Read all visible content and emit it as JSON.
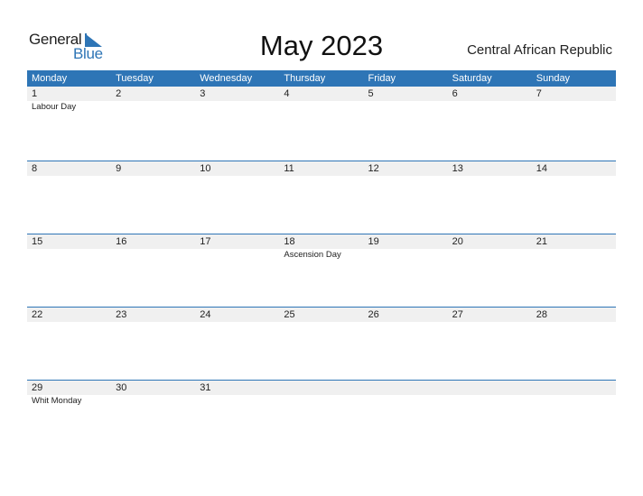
{
  "logo": {
    "line1": "General",
    "line2": "Blue"
  },
  "title": "May 2023",
  "country": "Central African Republic",
  "colors": {
    "accent": "#2e75b6",
    "strip": "#f0f0f0"
  },
  "weekdays": [
    "Monday",
    "Tuesday",
    "Wednesday",
    "Thursday",
    "Friday",
    "Saturday",
    "Sunday"
  ],
  "weeks": [
    [
      {
        "day": "1",
        "holiday": "Labour Day"
      },
      {
        "day": "2",
        "holiday": ""
      },
      {
        "day": "3",
        "holiday": ""
      },
      {
        "day": "4",
        "holiday": ""
      },
      {
        "day": "5",
        "holiday": ""
      },
      {
        "day": "6",
        "holiday": ""
      },
      {
        "day": "7",
        "holiday": ""
      }
    ],
    [
      {
        "day": "8",
        "holiday": ""
      },
      {
        "day": "9",
        "holiday": ""
      },
      {
        "day": "10",
        "holiday": ""
      },
      {
        "day": "11",
        "holiday": ""
      },
      {
        "day": "12",
        "holiday": ""
      },
      {
        "day": "13",
        "holiday": ""
      },
      {
        "day": "14",
        "holiday": ""
      }
    ],
    [
      {
        "day": "15",
        "holiday": ""
      },
      {
        "day": "16",
        "holiday": ""
      },
      {
        "day": "17",
        "holiday": ""
      },
      {
        "day": "18",
        "holiday": "Ascension Day"
      },
      {
        "day": "19",
        "holiday": ""
      },
      {
        "day": "20",
        "holiday": ""
      },
      {
        "day": "21",
        "holiday": ""
      }
    ],
    [
      {
        "day": "22",
        "holiday": ""
      },
      {
        "day": "23",
        "holiday": ""
      },
      {
        "day": "24",
        "holiday": ""
      },
      {
        "day": "25",
        "holiday": ""
      },
      {
        "day": "26",
        "holiday": ""
      },
      {
        "day": "27",
        "holiday": ""
      },
      {
        "day": "28",
        "holiday": ""
      }
    ],
    [
      {
        "day": "29",
        "holiday": "Whit Monday"
      },
      {
        "day": "30",
        "holiday": ""
      },
      {
        "day": "31",
        "holiday": ""
      },
      {
        "day": "",
        "holiday": ""
      },
      {
        "day": "",
        "holiday": ""
      },
      {
        "day": "",
        "holiday": ""
      },
      {
        "day": "",
        "holiday": ""
      }
    ]
  ]
}
